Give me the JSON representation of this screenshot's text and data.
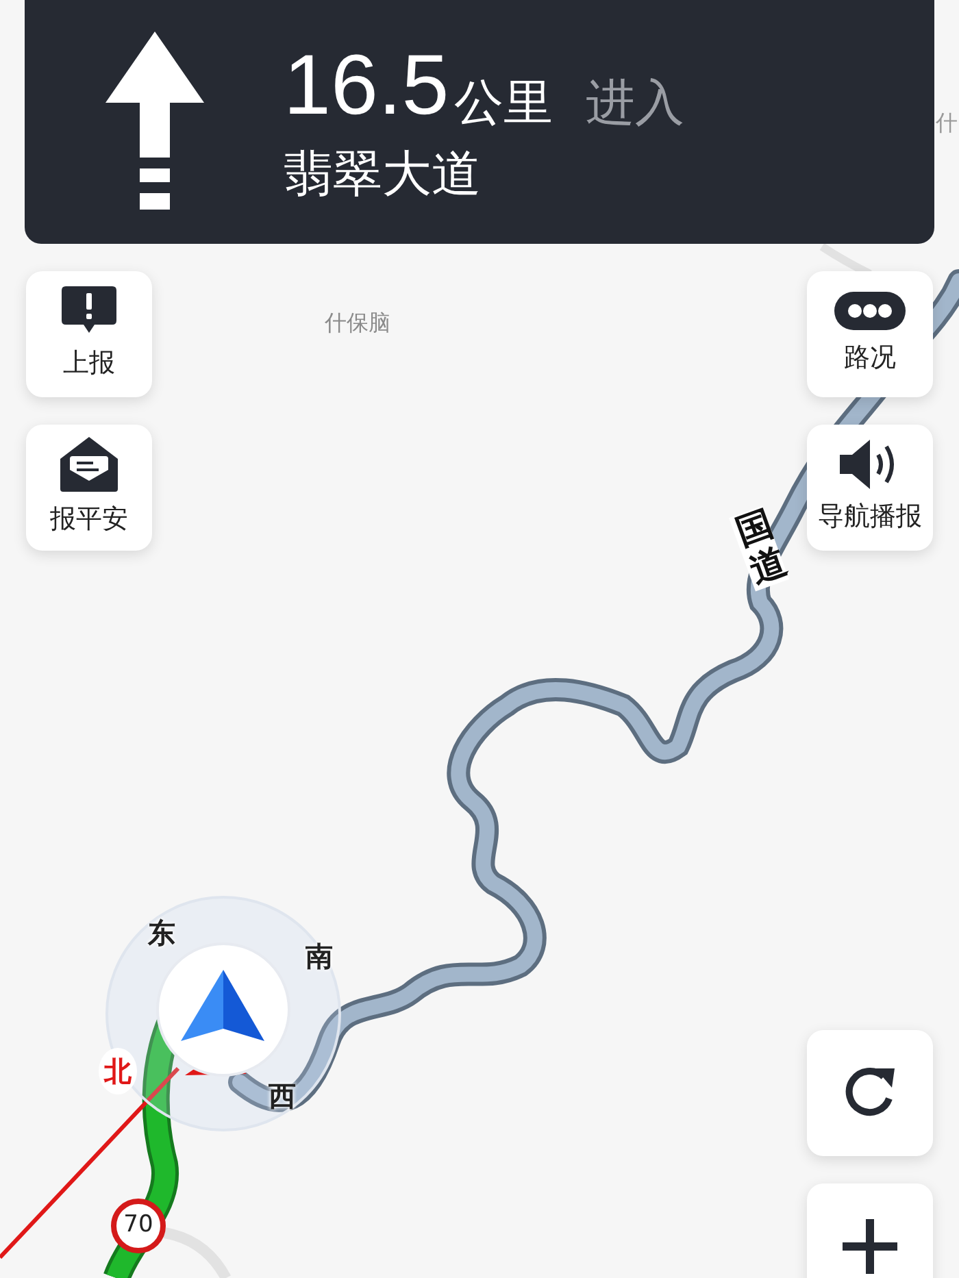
{
  "guidance": {
    "distance": "16.5",
    "unit": "公里",
    "action": "进入",
    "road": "翡翠大道"
  },
  "left_buttons": [
    {
      "label": "上报",
      "kind": "report"
    },
    {
      "label": "报平安",
      "kind": "safe"
    }
  ],
  "right_buttons": [
    {
      "label": "路况",
      "kind": "traffic"
    },
    {
      "label": "导航播报",
      "kind": "voice"
    }
  ],
  "map_labels": [
    {
      "text": "什保脑",
      "kind": "place"
    },
    {
      "text": "什",
      "kind": "edge"
    },
    {
      "text": "国道",
      "kind": "road"
    }
  ],
  "compass": {
    "north": "北",
    "east": "东",
    "south": "南",
    "west": "西"
  },
  "speed_limit": "70",
  "map_controls": [
    {
      "kind": "refresh"
    },
    {
      "kind": "zoom-in"
    }
  ]
}
